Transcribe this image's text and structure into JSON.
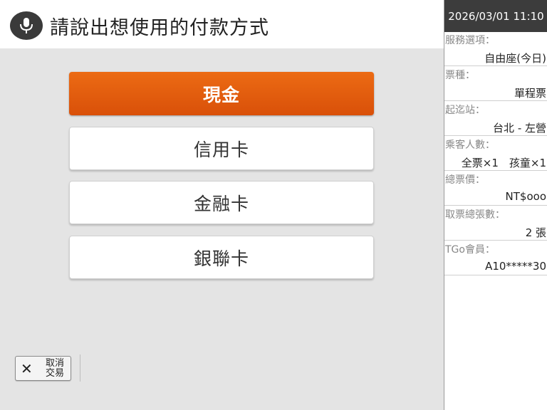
{
  "header": {
    "title": "請說出想使用的付款方式",
    "icon": "microphone-icon"
  },
  "payment_options": [
    {
      "label": "現金",
      "selected": true
    },
    {
      "label": "信用卡",
      "selected": false
    },
    {
      "label": "金融卡",
      "selected": false
    },
    {
      "label": "銀聯卡",
      "selected": false
    }
  ],
  "cancel": {
    "icon": "close-icon",
    "line1": "取消",
    "line2": "交易"
  },
  "sidebar": {
    "datetime": "2026/03/01 11:10",
    "items": [
      {
        "label": "服務選項：",
        "value": "自由座(今日)"
      },
      {
        "label": "票種：",
        "value": "單程票"
      },
      {
        "label": "起迄站：",
        "value": "台北 - 左營"
      },
      {
        "label": "乘客人數：",
        "value": "全票×1　孩童×1"
      },
      {
        "label": "總票價：",
        "value": "NT$ooo"
      },
      {
        "label": "取票總張數：",
        "value": "2 張"
      },
      {
        "label": "TGo會員：",
        "value": "A10*****30"
      }
    ]
  },
  "colors": {
    "primary_button": "#e3600e",
    "header_dark": "#3c3c3c",
    "background": "#e4e4e4"
  }
}
